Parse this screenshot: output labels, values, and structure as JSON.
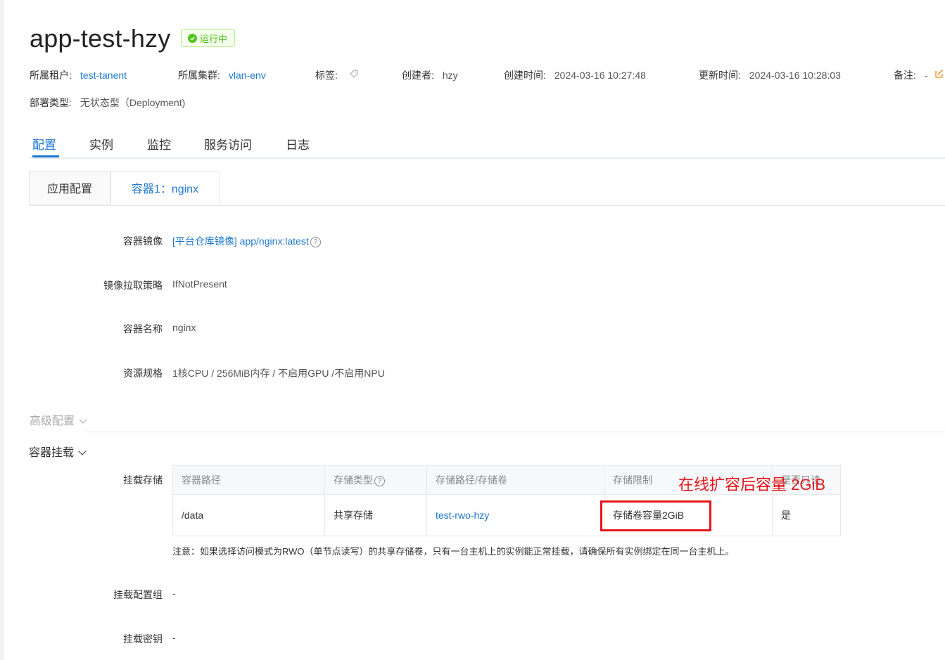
{
  "app": {
    "name": "app-test-hzy",
    "status": "运行中"
  },
  "meta": {
    "tenant_label": "所属租户:",
    "tenant": "test-tanent",
    "cluster_label": "所属集群:",
    "cluster": "vlan-env",
    "tags_label": "标签:",
    "creator_label": "创建者:",
    "creator": "hzy",
    "created_label": "创建时间:",
    "created": "2024-03-16 10:27:48",
    "updated_label": "更新时间:",
    "updated": "2024-03-16 10:28:03",
    "remark_label": "备注:",
    "remark": "-",
    "deploy_label": "部署类型:",
    "deploy": "无状态型（Deployment)"
  },
  "tabs": [
    "配置",
    "实例",
    "监控",
    "服务访问",
    "日志"
  ],
  "subtabs": [
    "应用配置",
    "容器1：nginx"
  ],
  "fields": {
    "image_label": "容器镜像",
    "image": "[平台仓库镜像] app/nginx:latest",
    "pull_label": "镜像拉取策略",
    "pull": "IfNotPresent",
    "name_label": "容器名称",
    "name": "nginx",
    "spec_label": "资源规格",
    "spec": "1核CPU / 256MiB内存 / 不启用GPU /不启用NPU"
  },
  "sections": {
    "advanced": "高级配置",
    "mount": "容器挂载"
  },
  "mount": {
    "storage_label": "挂载存储",
    "headers": [
      "容器路径",
      "存储类型",
      "存储路径/存储卷",
      "存储限制",
      "是否只读"
    ],
    "row": [
      "/data",
      "共享存储",
      "test-rwo-hzy",
      "存储卷容量2GiB",
      "是"
    ],
    "note": "注意：如果选择访问模式为RWO（单节点读写）的共享存储卷，只有一台主机上的实例能正常挂载，请确保所有实例绑定在同一台主机上。",
    "configmap_label": "挂载配置组",
    "configmap": "-",
    "secret_label": "挂载密钥",
    "secret": "-"
  },
  "annotation": "在线扩容后容量 2GiB",
  "colors": {
    "accent": "#1f78d1",
    "success": "#52c41a",
    "annotation": "#e4161b"
  }
}
